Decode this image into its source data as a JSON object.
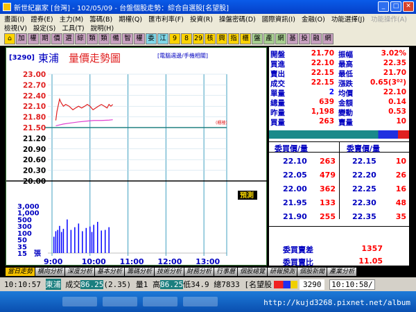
{
  "window": {
    "title": "新世紀贏家 [台灣] - 102/05/09 - 台盤個股走勢：綜合自選股[名望股]"
  },
  "menu1": [
    "畫面(I)",
    "證券(E)",
    "主力(M)",
    "籌碼(B)",
    "期權(Q)",
    "匯市利率(F)",
    "投資(R)",
    "操盤密碼(D)",
    "國際資訊(I)",
    "金融(O)",
    "功能選擇(J)",
    "功能操作(A)"
  ],
  "menu2": [
    "檢視(V)",
    "設定(S)",
    "工具(T)",
    "說明(H)"
  ],
  "toolbar": [
    {
      "t": "⌂",
      "bg": "#ffd400"
    },
    {
      "t": "加",
      "bg": "#c8a0c0"
    },
    {
      "t": "權",
      "bg": "#c8a0c0"
    },
    {
      "t": "期",
      "bg": "#c8a0c0"
    },
    {
      "t": "價",
      "bg": "#c8a0c0"
    },
    {
      "t": "選",
      "bg": "#c8a0c0"
    },
    {
      "t": "綜",
      "bg": "#c8a0c0"
    },
    {
      "t": "類",
      "bg": "#c8a0c0"
    },
    {
      "t": "類",
      "bg": "#c8a0c0"
    },
    {
      "t": "備",
      "bg": "#c8a0c0"
    },
    {
      "t": "智",
      "bg": "#c8a0c0"
    },
    {
      "t": "權",
      "bg": "#c8a0c0"
    },
    {
      "t": "委",
      "bg": "#7fd7e8"
    },
    {
      "t": "江",
      "bg": "#7fd7e8"
    },
    {
      "t": "9",
      "bg": "#ffd400"
    },
    {
      "t": "8",
      "bg": "#ffd400"
    },
    {
      "t": "29",
      "bg": "#ffd400"
    },
    {
      "t": "核",
      "bg": "#ffd400"
    },
    {
      "t": "興",
      "bg": "#ffd400"
    },
    {
      "t": "指",
      "bg": "#ffd400"
    },
    {
      "t": "櫃",
      "bg": "#ffd400"
    },
    {
      "t": "盤",
      "bg": "#a8d090"
    },
    {
      "t": "產",
      "bg": "#a8d090"
    },
    {
      "t": "網",
      "bg": "#a8d090"
    },
    {
      "t": "基",
      "bg": "#c8a0c0"
    },
    {
      "t": "投",
      "bg": "#c8a0c0"
    },
    {
      "t": "融",
      "bg": "#c8a0c0"
    },
    {
      "t": "網",
      "bg": "#c8a0c0"
    }
  ],
  "chart": {
    "code": "[3290]",
    "name": "東浦",
    "title": "量價走勢圖",
    "subtitle": "[電腦週邊/手機相關]",
    "ref_label": "(櫃檯)",
    "forecast": "預測",
    "vol_unit": "張"
  },
  "chart_data": {
    "type": "line",
    "title": "量價走勢圖",
    "y_price_ticks": [
      "23.00",
      "22.70",
      "22.40",
      "22.10",
      "21.80",
      "21.50",
      "21.20",
      "20.90",
      "20.60",
      "20.30",
      "20.00"
    ],
    "y_volume_ticks": [
      "3,000",
      "1,000",
      "500",
      "300",
      "100",
      "50",
      "35",
      "15"
    ],
    "x_ticks": [
      "9:00",
      "10:00",
      "11:00",
      "12:00",
      "13:00"
    ],
    "reference_price": 21.5,
    "ylim": [
      20.0,
      23.0
    ],
    "series": [
      {
        "name": "price",
        "color": "#e02020",
        "x": [
          9.1,
          9.13,
          9.16,
          9.2,
          9.24,
          9.3,
          9.36,
          9.45,
          9.55,
          9.62,
          9.7,
          9.78,
          9.86,
          9.93,
          10.0,
          10.08,
          10.15,
          10.22,
          10.3,
          10.38,
          10.45,
          10.5,
          10.55,
          10.6
        ],
        "y": [
          21.7,
          21.95,
          22.1,
          22.3,
          22.2,
          22.1,
          22.15,
          22.1,
          22.0,
          22.05,
          22.1,
          22.05,
          22.1,
          22.15,
          22.1,
          22.0,
          22.05,
          22.1,
          22.15,
          22.1,
          22.05,
          22.15,
          22.1,
          22.15
        ]
      },
      {
        "name": "average",
        "color": "#e040d0",
        "x": [
          9.1,
          9.3,
          9.5,
          9.7,
          9.9,
          10.1,
          10.3,
          10.5,
          10.6
        ],
        "y": [
          21.55,
          21.6,
          21.63,
          21.66,
          21.68,
          21.7,
          21.7,
          21.71,
          21.72
        ]
      }
    ],
    "volume": {
      "x": [
        9.05,
        9.1,
        9.15,
        9.2,
        9.25,
        9.3,
        9.4,
        9.5,
        9.6,
        9.7,
        9.8,
        9.9,
        10.0,
        10.05,
        10.1,
        10.2,
        10.3,
        10.4,
        10.5
      ],
      "v": [
        15,
        40,
        50,
        100,
        35,
        60,
        300,
        50,
        80,
        150,
        40,
        70,
        90,
        35,
        120,
        200,
        45,
        50,
        80
      ]
    }
  },
  "quote": {
    "rows": [
      {
        "l1": "開盤",
        "v1": "21.70",
        "c1": "#ff0000",
        "l2": "振幅",
        "v2": "3.02%",
        "c2": "#ff0000"
      },
      {
        "l1": "買進",
        "v1": "22.10",
        "c1": "#ff0000",
        "l2": "最高",
        "v2": "22.35",
        "c2": "#ff0000"
      },
      {
        "l1": "賣出",
        "v1": "22.15",
        "c1": "#ff0000",
        "l2": "最低",
        "v2": "21.70",
        "c2": "#ff0000"
      },
      {
        "l1": "成交",
        "v1": "22.15",
        "c1": "#ff0000",
        "l2": "漲跌",
        "v2": "0.65(3⁰²)",
        "c2": "#ff0000"
      },
      {
        "l1": "單量",
        "v1": "2",
        "c1": "#0000ff",
        "l2": "均價",
        "v2": "22.10",
        "c2": "#ff0000"
      },
      {
        "l1": "總量",
        "v1": "639",
        "c1": "#ff0000",
        "l2": "金額",
        "v2": "0.14",
        "c2": "#ff0000"
      },
      {
        "l1": "昨量",
        "v1": "1,198",
        "c1": "#ff0000",
        "l2": "變動",
        "v2": "0.53",
        "c2": "#ff0000"
      },
      {
        "l1": "買量",
        "v1": "263",
        "c1": "#ff0000",
        "l2": "賣量",
        "v2": "10",
        "c2": "#ff0000"
      }
    ]
  },
  "orderbook": {
    "bid_header": "委買價/量",
    "ask_header": "委賣價/量",
    "rows": [
      {
        "bp": "22.10",
        "bq": "263",
        "ap": "22.15",
        "aq": "10"
      },
      {
        "bp": "22.05",
        "bq": "479",
        "ap": "22.20",
        "aq": "26"
      },
      {
        "bp": "22.00",
        "bq": "362",
        "ap": "22.25",
        "aq": "16"
      },
      {
        "bp": "21.95",
        "bq": "133",
        "ap": "22.30",
        "aq": "48"
      },
      {
        "bp": "21.90",
        "bq": "255",
        "ap": "22.35",
        "aq": "35"
      }
    ],
    "diff_label": "委買賣差",
    "diff_value": "1357",
    "ratio_label": "委買賣比",
    "ratio_value": "11.05"
  },
  "tabs": [
    "當日走勢",
    "橫向分析",
    "深度分析",
    "基本分析",
    "籌碼分析",
    "技術分析",
    "財務分析",
    "行事曆",
    "個股總覽",
    "研報預測",
    "個股新聞",
    "產業分析"
  ],
  "status": {
    "time": "10:10:57",
    "name": "東浦",
    "detail_a": "成交",
    "detail_b": "86.25",
    "detail_c": "(2.35) 量1 高",
    "detail_d": "86.25",
    "detail_e": " 低34.9 總7833 [名望股",
    "code": "3290",
    "clock": "10:10:58/"
  },
  "url": "http://kujd3268.pixnet.net/album"
}
